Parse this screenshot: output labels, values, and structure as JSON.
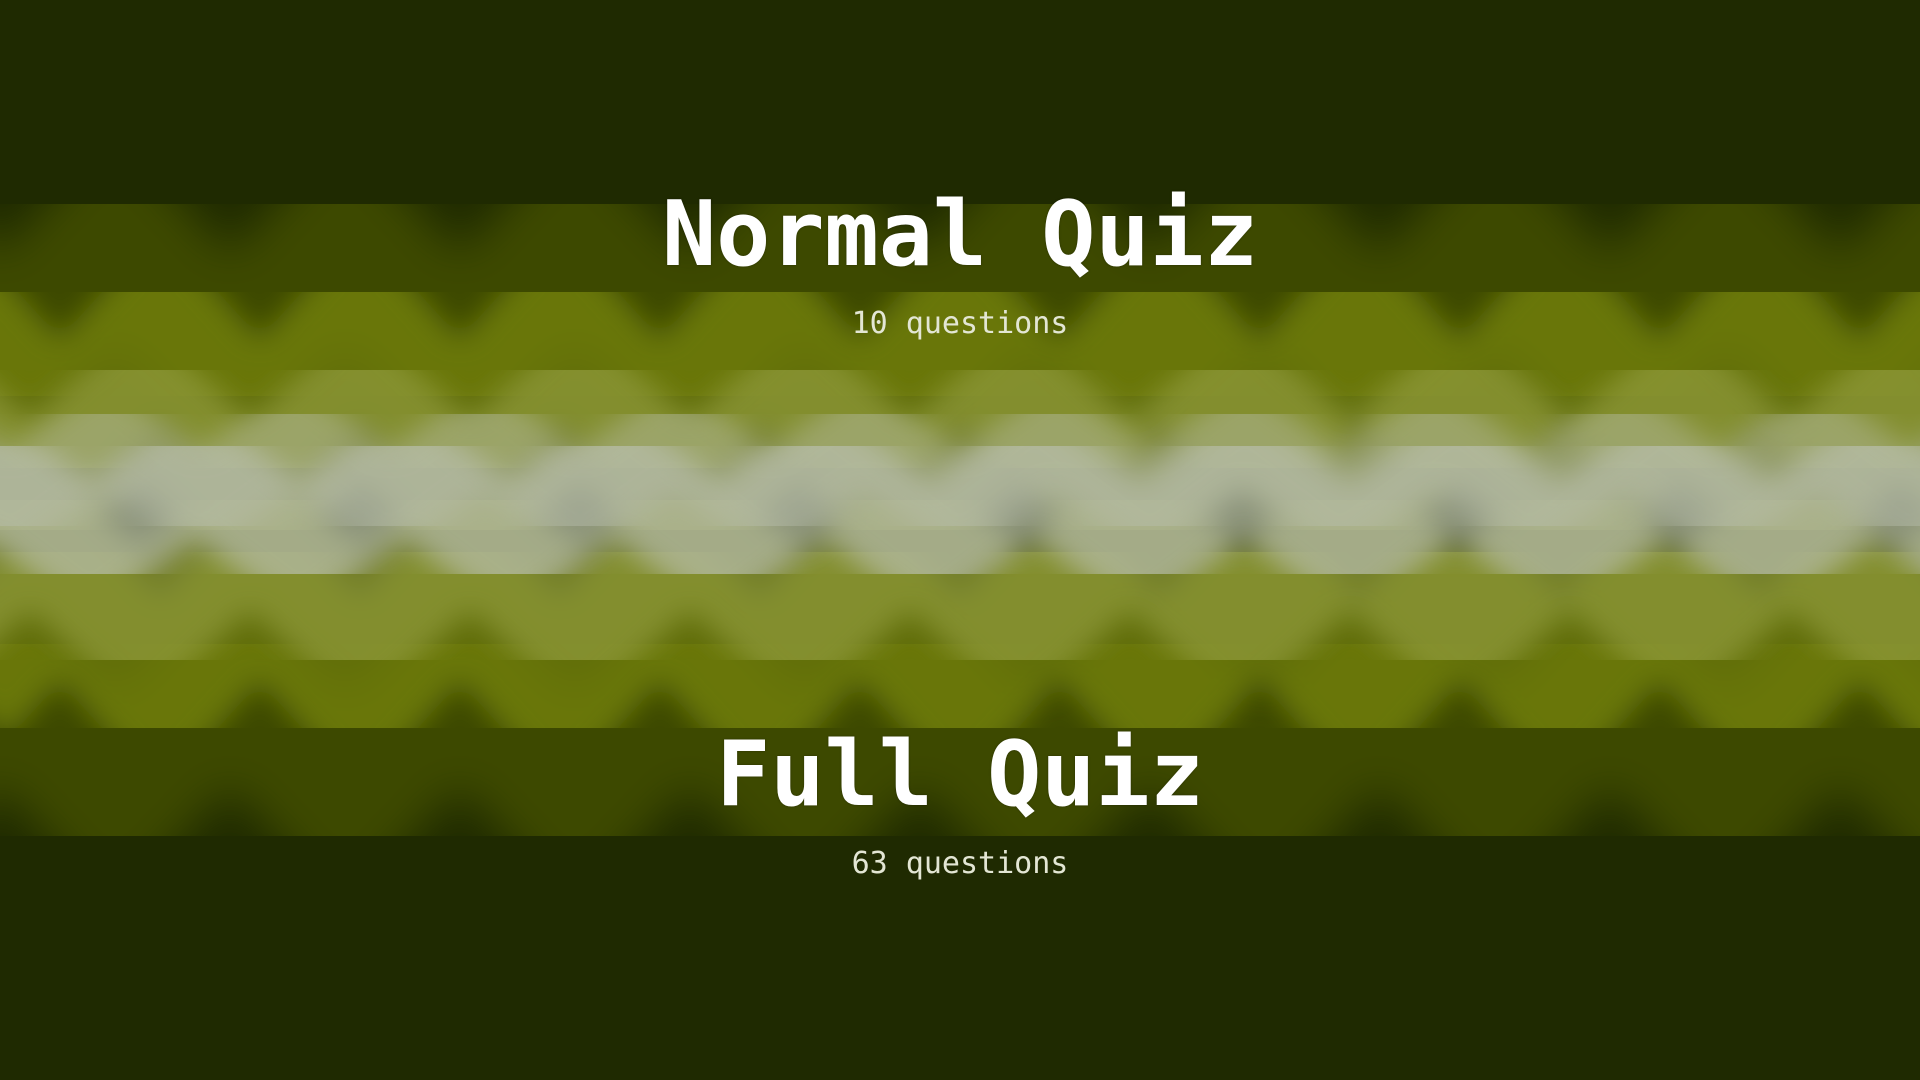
{
  "screen": {
    "background_color": "#1f2a01",
    "wave_colors": [
      "#7c8a0c",
      "#8f9a3a",
      "#b9bfae",
      "#566400"
    ]
  },
  "menu": {
    "options": [
      {
        "title": "Normal Quiz",
        "subtitle": "10 questions"
      },
      {
        "title": "Full Quiz",
        "subtitle": "63 questions"
      }
    ]
  }
}
